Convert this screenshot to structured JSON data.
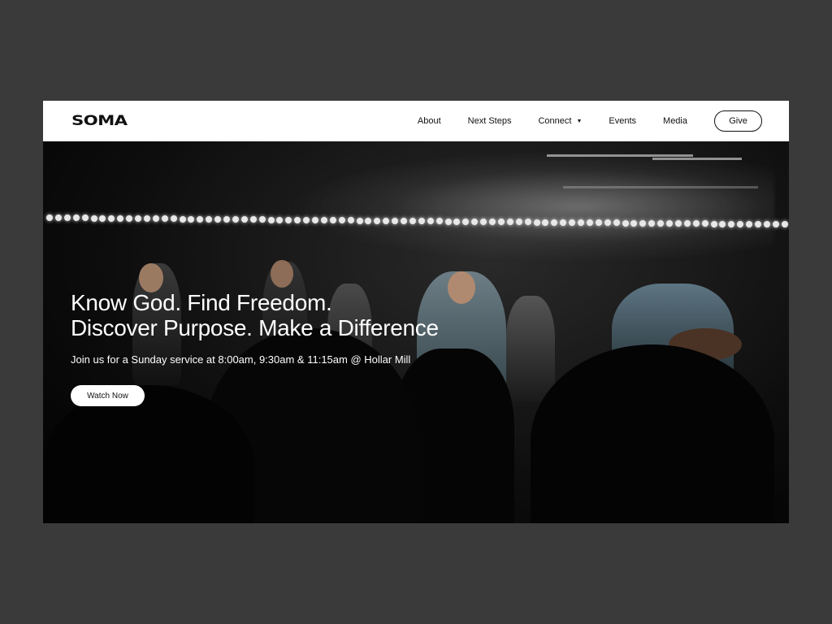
{
  "brand": {
    "logo_text": "SOMA"
  },
  "nav": {
    "items": [
      {
        "label": "About"
      },
      {
        "label": "Next Steps"
      },
      {
        "label": "Connect",
        "has_dropdown": true
      },
      {
        "label": "Events"
      },
      {
        "label": "Media"
      }
    ],
    "give_label": "Give"
  },
  "hero": {
    "headline_line1": "Know God. Find Freedom.",
    "headline_line2": "Discover Purpose. Make a Difference",
    "subtext": "Join us for a Sunday service at 8:00am, 9:30am & 11:15am @ Hollar Mill",
    "cta_label": "Watch Now",
    "image": "worship-band-on-stage-photo"
  },
  "colors": {
    "backdrop": "#3a3a3a",
    "nav_bg": "#ffffff",
    "text_dark": "#111111",
    "hero_text": "#ffffff"
  }
}
